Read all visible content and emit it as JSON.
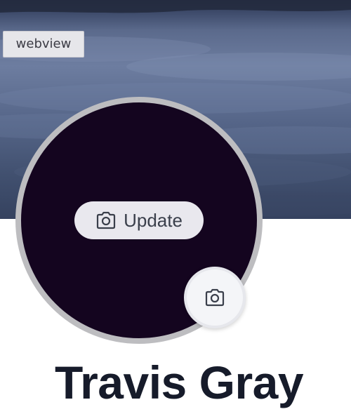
{
  "badge": {
    "label": "webview"
  },
  "avatar": {
    "update_label": "Update",
    "fill_color": "#14051f",
    "ring_color": "#bdbdc0"
  },
  "icons": {
    "update": "camera-icon",
    "corner_button": "camera-icon"
  },
  "profile": {
    "name": "Travis Gray"
  },
  "colors": {
    "name_text": "#161b2a",
    "button_bg": "#e9e8ee",
    "cover_sky": "#5b6a8c"
  }
}
